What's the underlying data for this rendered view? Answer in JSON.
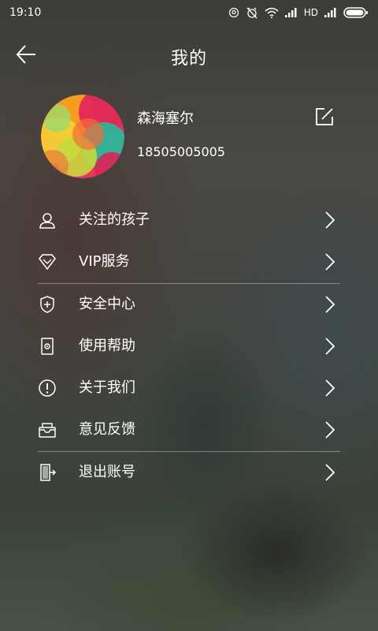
{
  "status_bar": {
    "time": "19:10",
    "network": "HD"
  },
  "header": {
    "title": "我的"
  },
  "profile": {
    "name": "森海塞尔",
    "phone": "18505005005"
  },
  "menu": {
    "items": [
      {
        "label": "关注的孩子",
        "icon": "child-user-icon"
      },
      {
        "label": "VIP服务",
        "icon": "diamond-icon"
      },
      {
        "label": "安全中心",
        "icon": "shield-icon"
      },
      {
        "label": "使用帮助",
        "icon": "help-doc-icon"
      },
      {
        "label": "关于我们",
        "icon": "info-circle-icon"
      },
      {
        "label": "意见反馈",
        "icon": "feedback-tray-icon"
      },
      {
        "label": "退出账号",
        "icon": "logout-door-icon"
      }
    ]
  },
  "colors": {
    "text": "#ffffff",
    "divider": "rgba(255,255,255,0.35)"
  }
}
